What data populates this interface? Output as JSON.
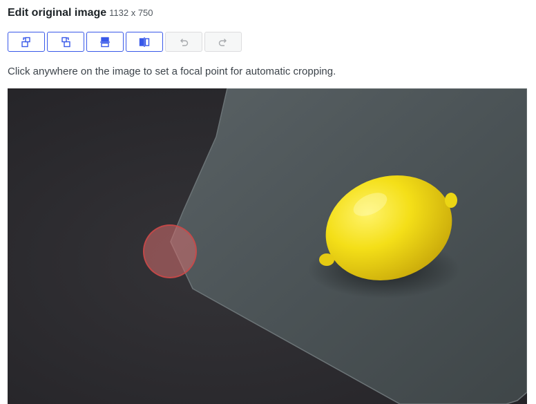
{
  "header": {
    "title": "Edit original image",
    "dimensions": "1132 x 750"
  },
  "toolbar": {
    "buttons": [
      {
        "icon": "rotate-left-icon",
        "enabled": true
      },
      {
        "icon": "rotate-right-icon",
        "enabled": true
      },
      {
        "icon": "flip-vertical-icon",
        "enabled": true
      },
      {
        "icon": "flip-horizontal-icon",
        "enabled": true
      },
      {
        "icon": "undo-icon",
        "enabled": false
      },
      {
        "icon": "redo-icon",
        "enabled": false
      }
    ]
  },
  "instructions": "Click anywhere on the image to set a focal point for automatic cropping.",
  "colors": {
    "accent": "#3858e9",
    "disabled_border": "#dcdcde",
    "focal_fill": "#d26e6e",
    "lemon": "#f2dc17",
    "slate": "#4b5356",
    "background": "#2b2a2d"
  }
}
